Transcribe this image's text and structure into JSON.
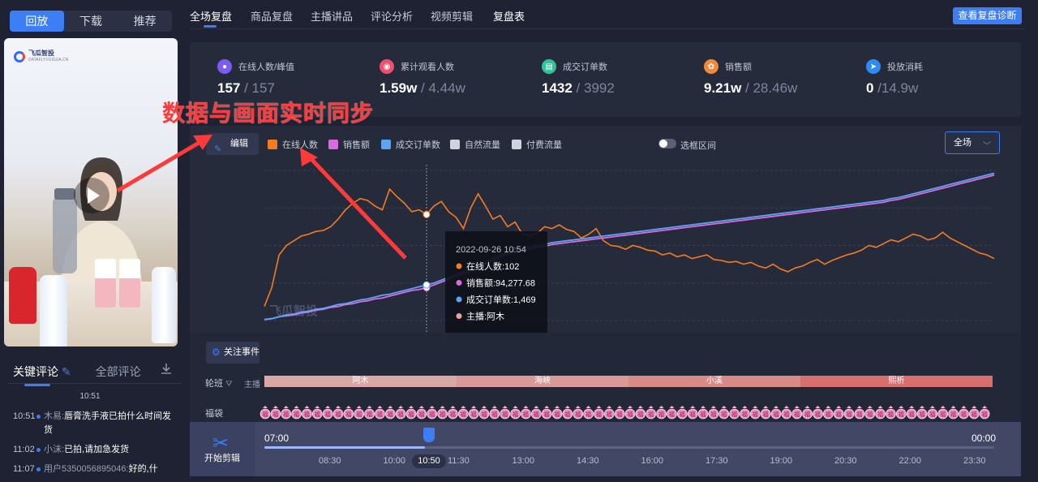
{
  "video_tabs": [
    "回放",
    "下载",
    "推荐"
  ],
  "brand": {
    "name": "飞瓜智投",
    "sub": "DATAFLY.FEIGUA.CN"
  },
  "overlay_annotation": "数据与画面实时同步",
  "comments": {
    "tabs": [
      "关键评论",
      "全部评论"
    ],
    "time_header": "10:51",
    "items": [
      {
        "time": "10:51",
        "user": "木易:",
        "text": "唇膏洗手液已拍什么时间发货"
      },
      {
        "time": "11:02",
        "user": "小沫:",
        "text": "已拍,请加急发货"
      },
      {
        "time": "11:07",
        "user": "用户5350056895046:",
        "text": "好的,什"
      }
    ]
  },
  "nav": {
    "items": [
      "全场复盘",
      "商品复盘",
      "主播讲品",
      "评论分析",
      "视频剪辑",
      "复盘表"
    ],
    "diag_button": "查看复盘诊断"
  },
  "stats": [
    {
      "label": "在线人数/峰值",
      "value": "157",
      "sub": " / 157",
      "color": "#7b5cf0",
      "icon": "user-icon"
    },
    {
      "label": "累计观看人数",
      "value": "1.59w",
      "sub": " / 4.44w",
      "color": "#f0506e",
      "icon": "eye-icon"
    },
    {
      "label": "成交订单数",
      "value": "1432",
      "sub": " / 3992",
      "color": "#2fc39b",
      "icon": "order-icon"
    },
    {
      "label": "销售额",
      "value": "9.21w",
      "sub": " / 28.46w",
      "color": "#f08a3a",
      "icon": "money-icon"
    },
    {
      "label": "投放消耗",
      "value": "0",
      "sub": " /14.9w",
      "color": "#2e8cf0",
      "icon": "send-icon"
    }
  ],
  "chart_toolbar": {
    "edit_label": "编辑",
    "legend": [
      {
        "name": "在线人数",
        "color": "#f47c20"
      },
      {
        "name": "销售额",
        "color": "#d86be0"
      },
      {
        "name": "成交订单数",
        "color": "#5aa6f5"
      },
      {
        "name": "自然流量",
        "color": "#d0d3dc"
      },
      {
        "name": "付费流量",
        "color": "#d0d3dc"
      }
    ],
    "range_toggle_label": "选框区间",
    "scope_select": "全场"
  },
  "chart_data": {
    "type": "line",
    "tooltip": {
      "time": "2022-09-26 10:54",
      "rows": [
        {
          "label": "在线人数:",
          "value": "102",
          "color": "#f47c20"
        },
        {
          "label": "销售额:",
          "value": "94,277.68",
          "color": "#d86be0"
        },
        {
          "label": "成交订单数:",
          "value": "1,469",
          "color": "#5aa6f5"
        },
        {
          "label": "主播:",
          "value": "阿木",
          "color": "#e0a8a0"
        }
      ]
    },
    "watermark": "飞瓜智投",
    "series": [
      {
        "name": "在线人数",
        "values": [
          15,
          35,
          70,
          80,
          85,
          90,
          92,
          95,
          96,
          100,
          108,
          118,
          125,
          130,
          128,
          122,
          118,
          140,
          132,
          125,
          116,
          118,
          113,
          122,
          127,
          116,
          110,
          98,
          120,
          135,
          122,
          108,
          112,
          100,
          105,
          92,
          90,
          93,
          100,
          98,
          102,
          97,
          95,
          88,
          92,
          98,
          85,
          80,
          79,
          76,
          80,
          78,
          75,
          74,
          70,
          72,
          68,
          70,
          66,
          68,
          70,
          65,
          64,
          62,
          63,
          60,
          62,
          58,
          56,
          60,
          55,
          52,
          56,
          58,
          62,
          65,
          60,
          64,
          67,
          70,
          72,
          75,
          80,
          78,
          82,
          86,
          84,
          88,
          92,
          90,
          86,
          88,
          94,
          88,
          84,
          80,
          76,
          72,
          70,
          66
        ]
      },
      {
        "name": "销售额",
        "values": [
          1,
          2,
          4,
          5,
          6,
          8,
          9,
          11,
          12,
          14,
          15,
          17,
          18,
          20,
          21,
          23,
          24,
          26,
          28,
          30,
          32,
          33,
          35,
          38,
          41,
          44,
          47,
          50,
          53,
          56,
          60,
          64,
          68,
          71,
          73,
          75,
          76,
          78,
          79,
          81,
          82,
          83,
          84,
          85,
          86,
          87,
          88,
          89,
          90,
          91,
          92,
          93,
          94,
          95,
          96,
          97,
          98,
          99,
          100,
          101,
          102,
          103,
          104,
          105,
          106,
          107,
          108,
          109,
          110,
          111,
          112,
          113,
          114,
          115,
          116,
          117,
          118,
          119,
          120,
          121,
          122,
          123,
          124,
          125,
          126,
          128,
          129,
          131,
          133,
          135,
          137,
          139,
          141,
          143,
          145,
          147,
          149,
          151,
          153,
          155
        ]
      },
      {
        "name": "成交订单数",
        "values": [
          1,
          2,
          4,
          6,
          7,
          9,
          10,
          12,
          13,
          15,
          17,
          18,
          20,
          22,
          23,
          25,
          27,
          28,
          30,
          32,
          34,
          36,
          38,
          40,
          43,
          46,
          49,
          52,
          55,
          58,
          62,
          66,
          70,
          73,
          75,
          77,
          78,
          80,
          81,
          83,
          84,
          85,
          86,
          87,
          88,
          89,
          90,
          91,
          92,
          93,
          94,
          95,
          96,
          97,
          98,
          99,
          100,
          101,
          102,
          103,
          104,
          105,
          106,
          107,
          108,
          109,
          110,
          111,
          112,
          113,
          114,
          115,
          116,
          117,
          118,
          119,
          120,
          121,
          122,
          123,
          124,
          125,
          126,
          127,
          128,
          130,
          131,
          133,
          135,
          137,
          139,
          141,
          143,
          145,
          147,
          149,
          151,
          153,
          155,
          157
        ]
      }
    ],
    "ylim": [
      0,
      160
    ]
  },
  "events": {
    "button": "关注事件",
    "rota_label": "轮班",
    "host_label": "主播",
    "hosts": [
      {
        "name": "阿木",
        "weight": 237,
        "color": "#d9a7a5"
      },
      {
        "name": "海峡",
        "weight": 212,
        "color": "#d99996"
      },
      {
        "name": "小溪",
        "weight": 212,
        "color": "#d88a87"
      },
      {
        "name": "熙析",
        "weight": 237,
        "color": "#d86f6f"
      }
    ],
    "bag_label": "福袋",
    "bag_count": 70,
    "bag_char": "福"
  },
  "timeline": {
    "button": "开始剪辑",
    "start": "07:00",
    "end": "00:00",
    "progress": 0.22,
    "ticks": [
      "08:30",
      "10:00",
      "11:30",
      "13:00",
      "14:30",
      "16:00",
      "17:30",
      "19:00",
      "20:30",
      "22:00",
      "23:30"
    ],
    "current": "10:50"
  }
}
